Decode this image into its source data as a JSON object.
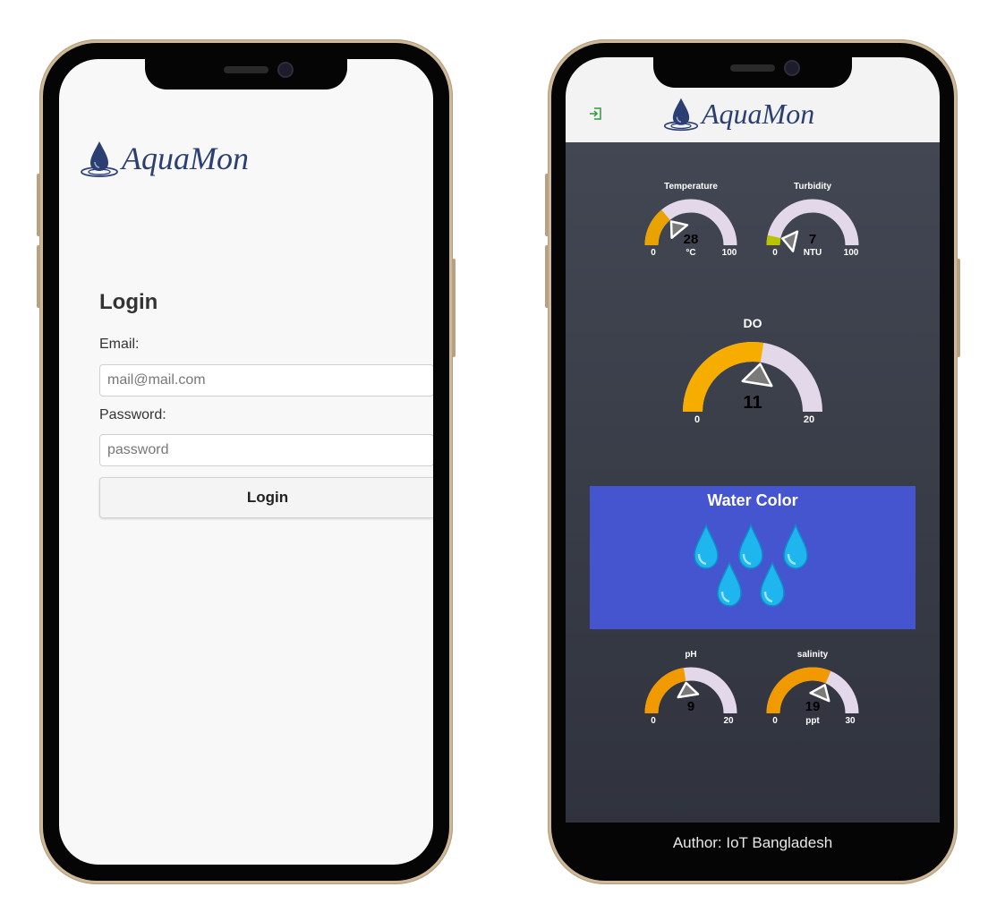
{
  "login_screen": {
    "brand": "AquaMon",
    "title": "Login",
    "email_label": "Email:",
    "email_placeholder": "mail@mail.com",
    "password_label": "Password:",
    "password_placeholder": "password",
    "login_button": "Login"
  },
  "dashboard_screen": {
    "brand": "AquaMon",
    "logout_icon": "logout-icon",
    "gauges": {
      "temperature": {
        "title": "Temperature",
        "value": "28",
        "min": "0",
        "max": "100",
        "unit": "°C",
        "fraction": 0.28,
        "color": "#e8a300"
      },
      "turbidity": {
        "title": "Turbidity",
        "value": "7",
        "min": "0",
        "max": "100",
        "unit": "NTU",
        "fraction": 0.07,
        "color": "#b9c400"
      },
      "do": {
        "title": "DO",
        "value": "11",
        "min": "0",
        "max": "20",
        "unit": "",
        "fraction": 0.55,
        "color": "#f6ad00"
      },
      "ph": {
        "title": "pH",
        "value": "9",
        "min": "0",
        "max": "20",
        "unit": "",
        "fraction": 0.45,
        "color": "#f09a00"
      },
      "salinity": {
        "title": "salinity",
        "value": "19",
        "min": "0",
        "max": "30",
        "unit": "ppt",
        "fraction": 0.63,
        "color": "#f09a00"
      }
    },
    "water_color": {
      "title": "Water Color",
      "panel_color": "#4555cf",
      "drop_color": "#1fb6ef"
    },
    "footer": "Author: IoT Bangladesh"
  },
  "colors": {
    "brand": "#2b3f73",
    "gauge_track": "#e3d8ea",
    "dashboard_bg": "#3a3e49",
    "frame": "#cdb89a"
  }
}
